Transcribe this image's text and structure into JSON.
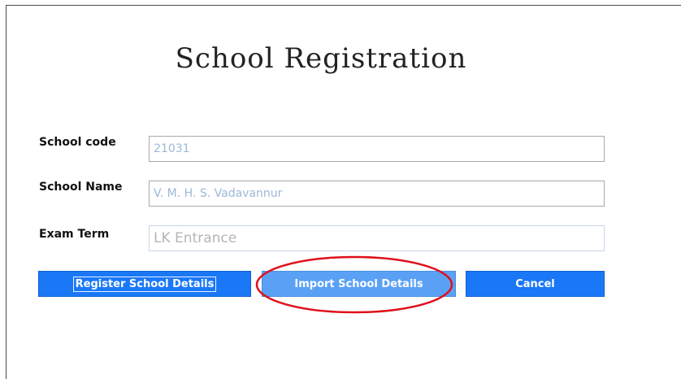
{
  "form": {
    "title": "School Registration",
    "fields": [
      {
        "label": "School code",
        "value": "21031"
      },
      {
        "label": "School Name",
        "value": "V. M. H. S. Vadavannur"
      },
      {
        "label": "Exam Term",
        "value": "LK Entrance"
      }
    ]
  },
  "buttons": {
    "register": "Register School Details",
    "import": "Import School Details",
    "cancel": "Cancel"
  },
  "colors": {
    "button": "#1a78f7",
    "button_hover": "#5aa1f5",
    "annotation": "#e0101a"
  }
}
